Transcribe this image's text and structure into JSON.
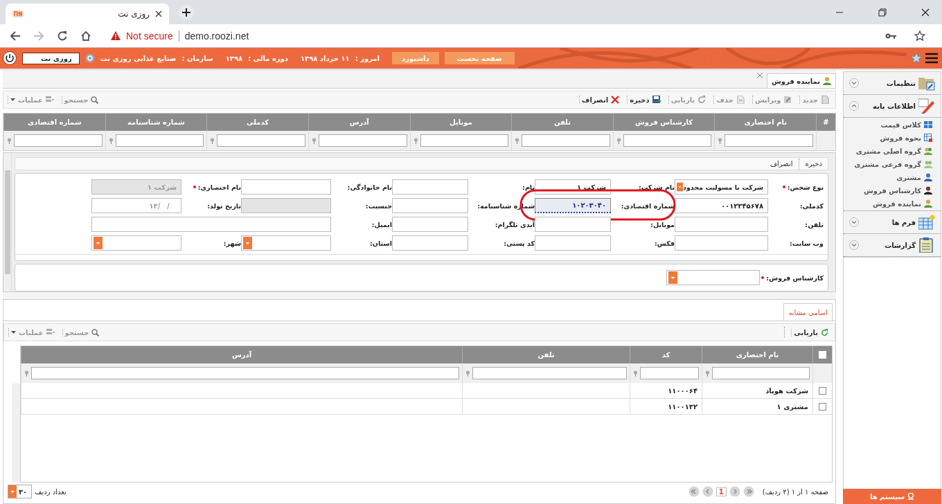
{
  "browser": {
    "tab_title": "روزی نت",
    "security": "Not secure",
    "url": "demo.roozi.net"
  },
  "header": {
    "nav": [
      {
        "label": "صفحه نخست"
      },
      {
        "label": "داشبورد"
      }
    ],
    "info": [
      {
        "label": "امروز :",
        "value": "۱۱ خرداد ۱۳۹۸"
      },
      {
        "label": "دوره مالی :",
        "value": "۱۳۹۸"
      },
      {
        "label": "سازمان :",
        "value": "صنایع غذایی روزی نت"
      }
    ],
    "user": "روزی نت"
  },
  "page_tab": {
    "label": "نماینده فروش"
  },
  "toolbar": {
    "actions": [
      {
        "label": "جدید",
        "kind": "new",
        "disabled": true
      },
      {
        "label": "ویرایش",
        "kind": "edit",
        "disabled": true
      },
      {
        "label": "حذف",
        "kind": "delete",
        "disabled": true
      },
      {
        "label": "بازیابی",
        "kind": "refresh",
        "disabled": true
      },
      {
        "label": "ذخیره",
        "kind": "save",
        "disabled": false
      },
      {
        "label": "انصراف",
        "kind": "cancel",
        "disabled": false
      }
    ],
    "search": "جستجو",
    "operations": "عملیات"
  },
  "grid": {
    "columns": [
      "#",
      "نام اختصاری",
      "کارشناس فروش",
      "تلفن",
      "موبایل",
      "آدرس",
      "کدملی",
      "شماره شناسنامه",
      "شماره اقتصادی"
    ]
  },
  "form": {
    "actions": [
      "ذخیره",
      "انصراف"
    ],
    "rows": [
      {
        "fields": [
          {
            "label": "نوع شخص:",
            "kind": "select",
            "value": "شرکت با مسولیت محدود",
            "required": true,
            "disabled": false,
            "highlighted": false
          },
          {
            "label": "نام شرکت:",
            "kind": "text",
            "value": "شرکت ۱",
            "required": false,
            "disabled": false,
            "highlighted": false
          },
          {
            "label": "نام:",
            "kind": "text",
            "required": false,
            "disabled": false,
            "highlighted": false
          },
          {
            "label": "نام خانوادگی:",
            "kind": "text",
            "required": false,
            "disabled": false,
            "highlighted": false
          },
          {
            "label": "نام اختصاری:",
            "kind": "text",
            "value": "شرکت ۱",
            "required": true,
            "disabled": true,
            "highlighted": false
          }
        ]
      },
      {
        "fields": [
          {
            "label": "کدملی:",
            "kind": "text",
            "value": "۰۰۱۲۳۴۵۶۷۸",
            "required": false,
            "disabled": false,
            "highlighted": false
          },
          {
            "label": "شماره اقتصادی:",
            "kind": "text",
            "value": "۱۰۲۰۳۰۴۰",
            "required": false,
            "disabled": false,
            "highlighted": true
          },
          {
            "label": "شماره شناسنامه:",
            "kind": "text",
            "required": false,
            "disabled": false,
            "highlighted": false
          },
          {
            "label": "جنسیت:",
            "kind": "text",
            "required": false,
            "disabled": true,
            "highlighted": false
          },
          {
            "label": "تاریخ تولد:",
            "kind": "date",
            "placeholder": "__/__/۱۳",
            "required": false,
            "disabled": false,
            "highlighted": false
          }
        ]
      },
      {
        "fields": [
          {
            "label": "تلفن:",
            "kind": "text",
            "required": false,
            "disabled": false,
            "highlighted": false
          },
          {
            "label": "موبایل:",
            "kind": "text",
            "required": false,
            "disabled": false,
            "highlighted": false
          },
          {
            "label": "آیدی تلگرام:",
            "kind": "text",
            "required": false,
            "disabled": false,
            "highlighted": false
          },
          {
            "label": "ایمیل:",
            "kind": "long",
            "required": false,
            "disabled": false,
            "highlighted": false
          }
        ]
      },
      {
        "fields": [
          {
            "label": "وب سایت:",
            "kind": "text",
            "required": false,
            "disabled": false,
            "highlighted": false
          },
          {
            "label": "فکس:",
            "kind": "text",
            "required": false,
            "disabled": false,
            "highlighted": false
          },
          {
            "label": "کد پستی:",
            "kind": "text",
            "required": false,
            "disabled": false,
            "highlighted": false
          },
          {
            "label": "استان:",
            "kind": "select",
            "required": false,
            "disabled": false,
            "highlighted": false
          },
          {
            "label": "شهر:",
            "kind": "select",
            "required": false,
            "disabled": false,
            "highlighted": false
          }
        ]
      }
    ],
    "expert": {
      "label": "کارشناس فروش:",
      "kind": "select",
      "required": true,
      "disabled": false,
      "highlighted": false
    }
  },
  "similar": {
    "tab": "اسامی مشابه",
    "refresh": "بازیابی",
    "search": "جستجو",
    "operations": "عملیات",
    "columns": [
      "نام اختصاری",
      "کد",
      "تلفن",
      "آدرس"
    ],
    "header_checked": false,
    "rows": [
      {
        "name": "شرکت هوپاد",
        "code": "۱۱۰۰۰۶۴",
        "checked": false
      },
      {
        "name": "مشتری ۱",
        "code": "۱۱۰۰۱۳۲",
        "checked": false
      }
    ]
  },
  "pager": {
    "summary": "صفحه ۱ از ۱ (۲ ردیف)",
    "page": "1",
    "page_size": "۳۰",
    "page_size_label": "تعداد ردیف"
  },
  "sidebar": {
    "sections": [
      {
        "label": "تنظیمات",
        "kind": "settings",
        "expanded": false
      },
      {
        "label": "اطلاعات پایه",
        "kind": "base",
        "expanded": true,
        "children": [
          {
            "label": "کلاس قیمت",
            "kind": "grid"
          },
          {
            "label": "نحوه فروش",
            "kind": "table"
          },
          {
            "label": "گروه اصلی مشتری",
            "kind": "group"
          },
          {
            "label": "گروه فرعی مشتری",
            "kind": "subgroup"
          },
          {
            "label": "مشتری",
            "kind": "person"
          },
          {
            "label": "کارشناس فروش",
            "kind": "expert"
          },
          {
            "label": "نماینده فروش",
            "kind": "agent"
          }
        ]
      },
      {
        "label": "فرم ها",
        "kind": "forms",
        "expanded": false
      },
      {
        "label": "گزارشات",
        "kind": "reports",
        "expanded": false
      }
    ],
    "footer": "سیستم ها"
  }
}
